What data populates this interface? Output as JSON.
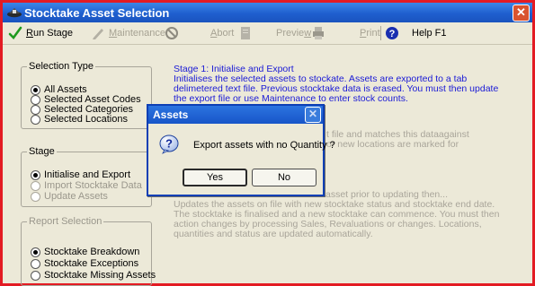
{
  "window": {
    "title": "Stocktake Asset Selection",
    "close_glyph": "✕"
  },
  "toolbar": {
    "run_stage": {
      "pre": "",
      "ul": "R",
      "post": "un Stage"
    },
    "maintenance": {
      "pre": "",
      "ul": "M",
      "post": "aintenance"
    },
    "abort": {
      "pre": "",
      "ul": "A",
      "post": "bort"
    },
    "preview": {
      "pre": "Previe",
      "ul": "w",
      "post": ""
    },
    "print": {
      "pre": "",
      "ul": "P",
      "post": "rint"
    },
    "help": "Help F1"
  },
  "selection_type": {
    "legend": "Selection Type",
    "options": [
      {
        "label": "All Assets",
        "selected": true
      },
      {
        "label": "Selected Asset Codes",
        "selected": false
      },
      {
        "label": "Selected Categories",
        "selected": false
      },
      {
        "label": "Selected Locations",
        "selected": false
      }
    ]
  },
  "stage": {
    "legend": "Stage",
    "options": [
      {
        "label": "Initialise and Export",
        "selected": true,
        "enabled": true
      },
      {
        "label": "Import Stocktake Data",
        "selected": false,
        "enabled": false
      },
      {
        "label": "Update Assets",
        "selected": false,
        "enabled": false
      }
    ]
  },
  "report_selection": {
    "legend": "Report Selection",
    "options": [
      {
        "label": "Stocktake Breakdown",
        "selected": true
      },
      {
        "label": "Stocktake Exceptions",
        "selected": false
      },
      {
        "label": "Stocktake Missing Assets",
        "selected": false
      }
    ]
  },
  "info": {
    "stage1_lines": [
      "Stage 1: Initialise and Export",
      "Initialises the selected assets to stockate.  Assets are exported to a tab",
      "delimetered text file.  Previous stocktake data is erased.  You must then update",
      "the export file or use Maintenance to enter stock counts."
    ],
    "stage2_partial_lines": [
      "t file and matches this dataagainst",
      "or new locations are marked for"
    ],
    "stage3_partial_first": "asset prior to updating then...",
    "stage3_lines": [
      "Updates the assets on file with new stocktake status and stocktake end date.",
      "The stocktake is finalised and a new stocktake can commence.  You must then",
      "action changes by processing Sales, Revaluations or changes.  Locations,",
      "quantities and status are updated automatically."
    ]
  },
  "dialog": {
    "title": "Assets",
    "close_glyph": "✕",
    "message": "Export assets with no Quantity ?",
    "yes_label": "Yes",
    "no_label": "No"
  },
  "colors": {
    "window_border": "#e31b23",
    "titlebar": "#1f5fcf",
    "info_text": "#1a1ad6",
    "face": "#ece9d8"
  }
}
